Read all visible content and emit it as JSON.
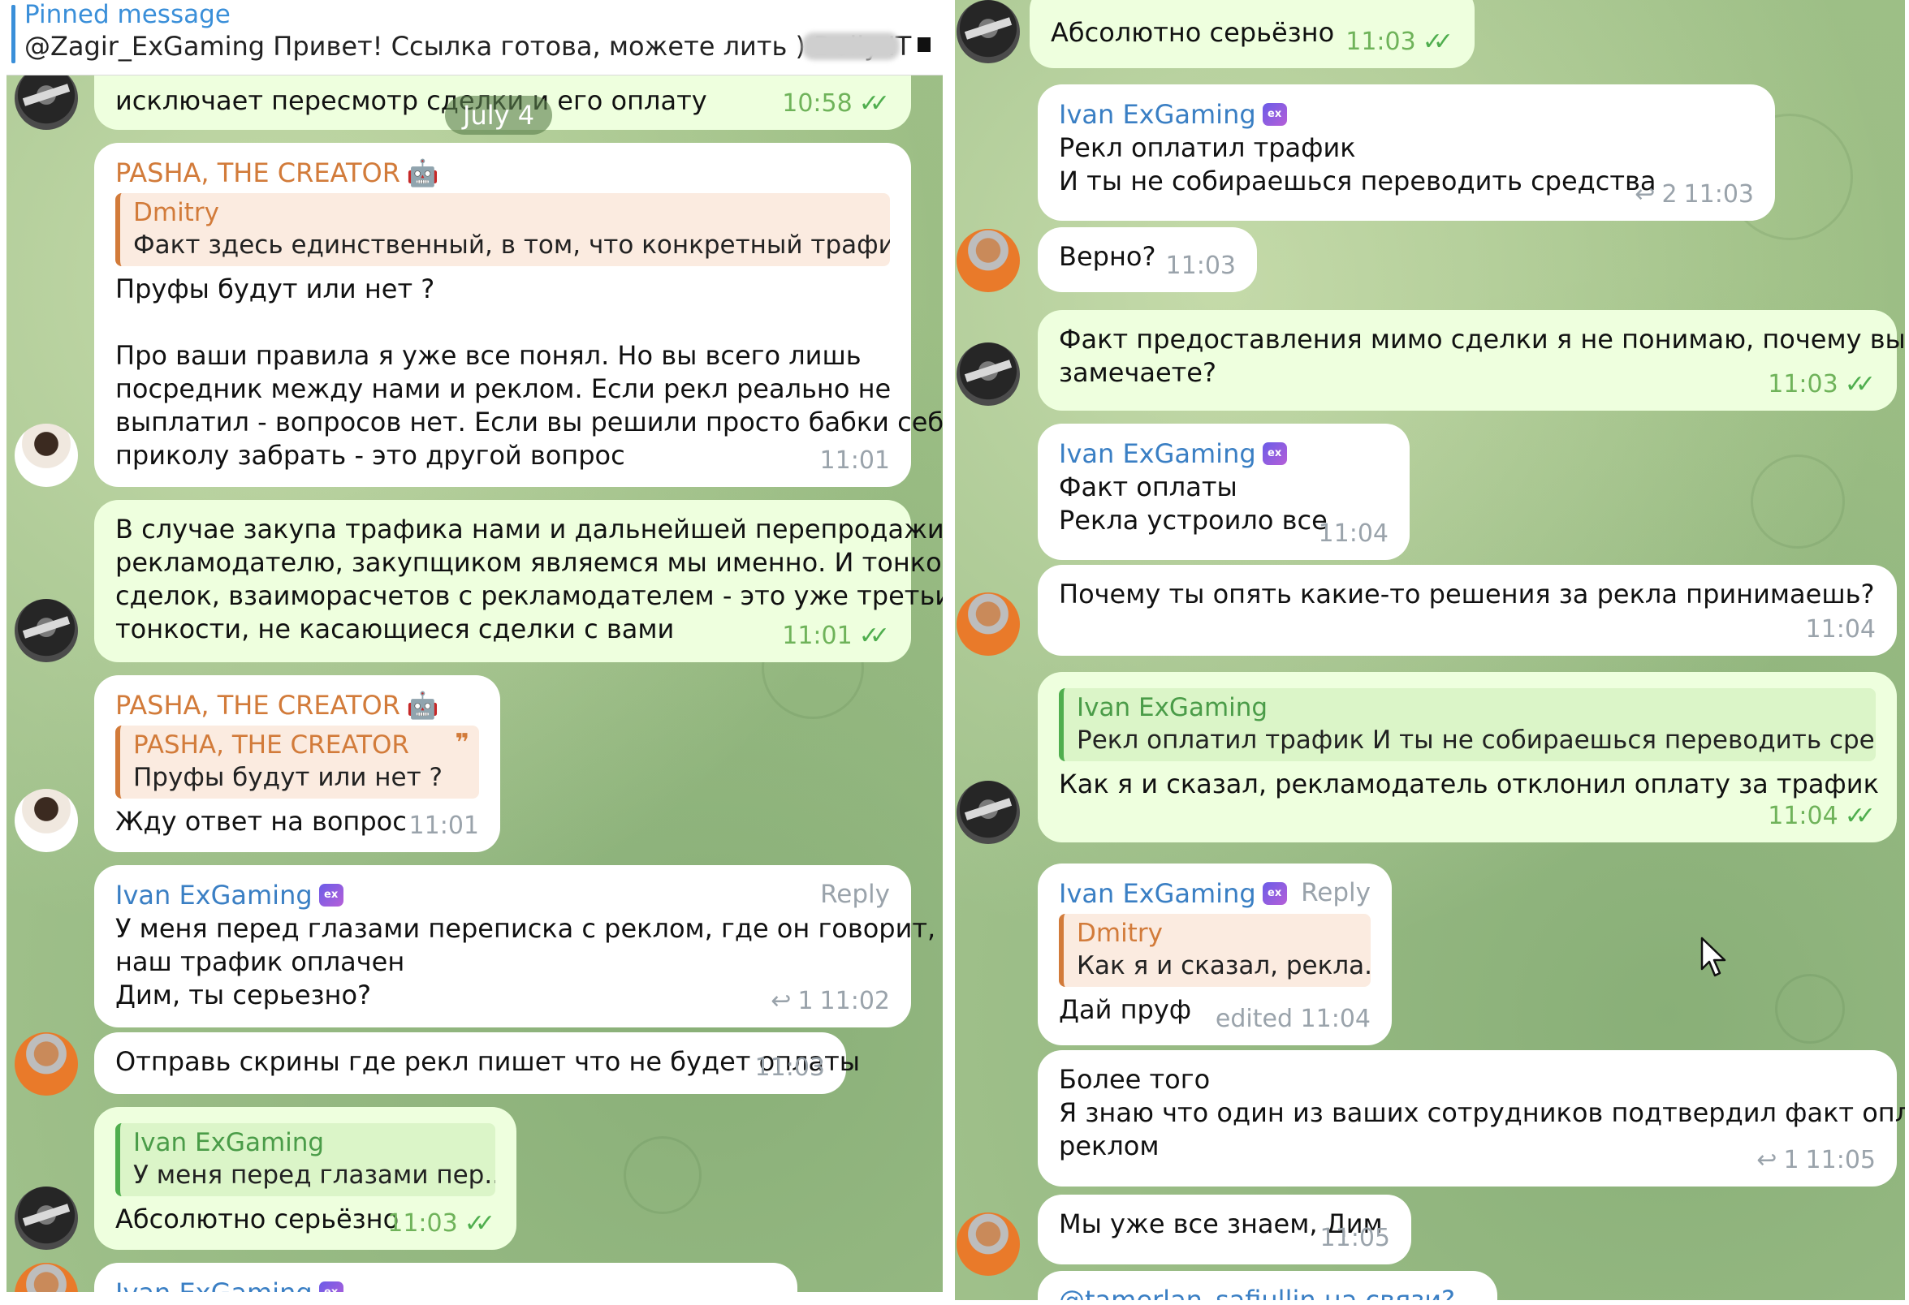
{
  "left": {
    "pinned": {
      "title": "Pinned message",
      "text": "@Zagir_ExGaming Привет! Ссылка готова, можете лить )   Dolly IT -"
    },
    "date_pill": "July 4",
    "messages": {
      "m1": {
        "text": "исключает пересмотр сделки и его оплату",
        "time": "10:58"
      },
      "m2": {
        "sender": "PASHA, THE CREATOR",
        "quote_name": "Dmitry",
        "quote_text": "Факт здесь единственный, в том, что конкретный трафик с к...",
        "line1": "Пруфы будут или нет ?",
        "line2": "Про ваши правила я уже все понял. Но вы всего лишь",
        "line3": "посредник между нами и реклом. Если рекл реально не",
        "line4": "выплатил - вопросов нет. Если вы решили просто бабки себе по",
        "line5": "приколу забрать - это другой вопрос",
        "time": "11:01"
      },
      "m3": {
        "line1": "В случае закупа трафика нами и дальнейшей перепродажи его",
        "line2": "рекламодателю, закупщиком являемся мы именно. И тонкости",
        "line3": "сделок, взаиморасчетов с рекламодателем - это уже третьи",
        "line4": "тонкости, не касающиеся сделки с вами",
        "time": "11:01"
      },
      "m4": {
        "sender": "PASHA, THE CREATOR",
        "quote_name": "PASHA, THE CREATOR",
        "quote_text": "Пруфы будут или нет ?",
        "text": "Жду ответ на вопрос",
        "time": "11:01"
      },
      "m5": {
        "sender": "Ivan ExGaming",
        "reply_label": "Reply",
        "line1": "У меня перед глазами переписка с реклом, где он говорит, что",
        "line2": "наш трафик оплачен",
        "line3": "Дим, ты серьезно?",
        "replies": "1",
        "time": "11:02"
      },
      "m6": {
        "text": "Отправь скрины где рекл пишет что не будет оплаты",
        "time": "11:03"
      },
      "m7": {
        "quote_name": "Ivan ExGaming",
        "quote_text": "У меня перед глазами пер...",
        "text": "Абсолютно серьёзно",
        "time": "11:03"
      },
      "m8": {
        "sender": "Ivan ExGaming"
      }
    }
  },
  "right": {
    "messages": {
      "r1": {
        "text": "Абсолютно серьёзно",
        "time": "11:03"
      },
      "r2": {
        "sender": "Ivan ExGaming",
        "line1": "Рекл оплатил трафик",
        "line2": "И ты не собираешься переводить средства",
        "replies": "2",
        "time": "11:03"
      },
      "r3": {
        "text": "Верно?",
        "time": "11:03"
      },
      "r4": {
        "line1": "Факт предоставления мимо сделки я не понимаю, почему вы не",
        "line2": "замечаете?",
        "time": "11:03"
      },
      "r5": {
        "sender": "Ivan ExGaming",
        "line1": "Факт оплаты",
        "line2": "Рекла устроило все",
        "time": "11:04"
      },
      "r6": {
        "text": "Почему ты опять какие-то решения за рекла принимаешь?",
        "time": "11:04"
      },
      "r7": {
        "quote_name": "Ivan ExGaming",
        "quote_text": "Рекл оплатил трафик И ты не собираешься переводить сред...",
        "text": "Как я и сказал, рекламодатель отклонил оплату за трафик",
        "time": "11:04"
      },
      "r8": {
        "sender": "Ivan ExGaming",
        "reply_label": "Reply",
        "quote_name": "Dmitry",
        "quote_text": "Как я и сказал, рекла...",
        "text": "Дай пруф",
        "time": "edited 11:04"
      },
      "r9": {
        "line1": "Более того",
        "line2": "Я знаю что один из ваших сотрудников подтвердил факт оплаты",
        "line3": "реклом",
        "replies": "1",
        "time": "11:05"
      },
      "r10": {
        "text": "Мы уже все знаем, Дим",
        "time": "11:05"
      },
      "r11": {
        "text": "@tamerlan_safiullin на связи?"
      }
    }
  },
  "colors": {
    "outgoing_bubble": "#eeffde",
    "incoming_bubble": "#ffffff",
    "name_orange": "#d27b3a",
    "name_blue": "#3a7fc4",
    "read_ticks": "#4fae4e"
  },
  "icons": [
    "pin-icon",
    "bot-emoji-icon",
    "exgaming-badge-icon",
    "reply-arrow-icon",
    "double-check-icon",
    "quote-mark-icon",
    "mouse-cursor-icon"
  ]
}
